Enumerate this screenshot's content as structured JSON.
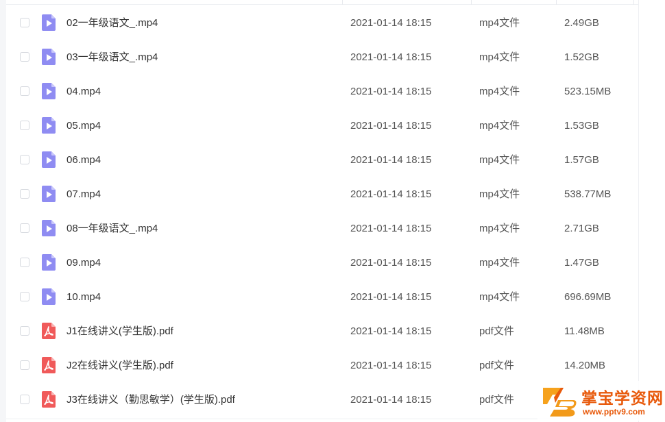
{
  "files": [
    {
      "name": "02一年级语文_.mp4",
      "date": "2021-01-14 18:15",
      "type": "mp4文件",
      "size": "2.49GB",
      "icon": "video-file-icon"
    },
    {
      "name": "03一年级语文_.mp4",
      "date": "2021-01-14 18:15",
      "type": "mp4文件",
      "size": "1.52GB",
      "icon": "video-file-icon"
    },
    {
      "name": "04.mp4",
      "date": "2021-01-14 18:15",
      "type": "mp4文件",
      "size": "523.15MB",
      "icon": "video-file-icon"
    },
    {
      "name": "05.mp4",
      "date": "2021-01-14 18:15",
      "type": "mp4文件",
      "size": "1.53GB",
      "icon": "video-file-icon"
    },
    {
      "name": "06.mp4",
      "date": "2021-01-14 18:15",
      "type": "mp4文件",
      "size": "1.57GB",
      "icon": "video-file-icon"
    },
    {
      "name": "07.mp4",
      "date": "2021-01-14 18:15",
      "type": "mp4文件",
      "size": "538.77MB",
      "icon": "video-file-icon"
    },
    {
      "name": "08一年级语文_.mp4",
      "date": "2021-01-14 18:15",
      "type": "mp4文件",
      "size": "2.71GB",
      "icon": "video-file-icon"
    },
    {
      "name": "09.mp4",
      "date": "2021-01-14 18:15",
      "type": "mp4文件",
      "size": "1.47GB",
      "icon": "video-file-icon"
    },
    {
      "name": "10.mp4",
      "date": "2021-01-14 18:15",
      "type": "mp4文件",
      "size": "696.69MB",
      "icon": "video-file-icon"
    },
    {
      "name": "J1在线讲义(学生版).pdf",
      "date": "2021-01-14 18:15",
      "type": "pdf文件",
      "size": "11.48MB",
      "icon": "pdf-file-icon"
    },
    {
      "name": "J2在线讲义(学生版).pdf",
      "date": "2021-01-14 18:15",
      "type": "pdf文件",
      "size": "14.20MB",
      "icon": "pdf-file-icon"
    },
    {
      "name": "J3在线讲义（勤思敏学）(学生版).pdf",
      "date": "2021-01-14 18:15",
      "type": "pdf文件",
      "size": "",
      "icon": "pdf-file-icon"
    }
  ],
  "colors": {
    "video_icon": "#8f8cf2",
    "pdf_icon": "#f05a5a",
    "watermark": "#e85a0c"
  },
  "watermark": {
    "title": "掌宝学资网",
    "url": "www.pptv9.com"
  }
}
